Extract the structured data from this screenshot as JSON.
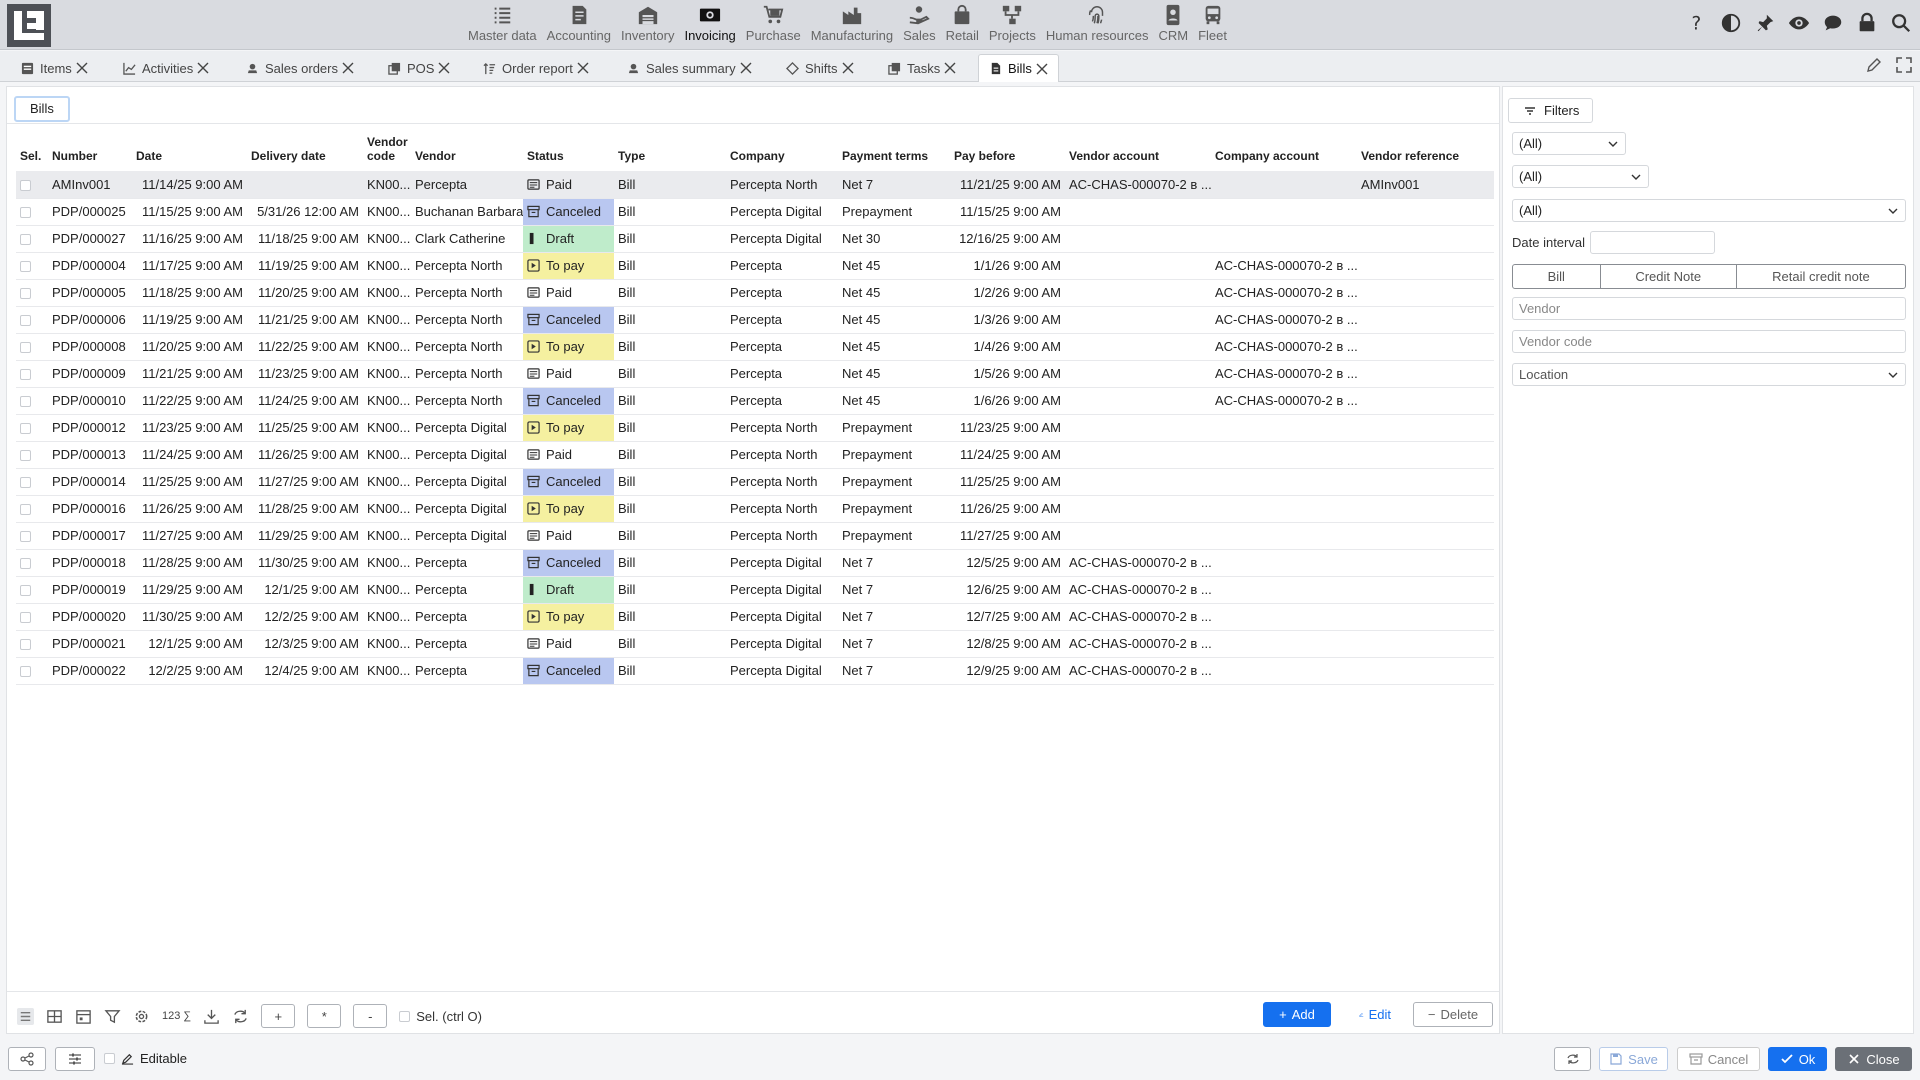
{
  "modules": [
    {
      "label": "Master data",
      "icon": "list-icon"
    },
    {
      "label": "Accounting",
      "icon": "document-icon"
    },
    {
      "label": "Inventory",
      "icon": "warehouse-icon"
    },
    {
      "label": "Invoicing",
      "icon": "money-icon"
    },
    {
      "label": "Purchase",
      "icon": "cart-icon"
    },
    {
      "label": "Manufacturing",
      "icon": "factory-icon"
    },
    {
      "label": "Sales",
      "icon": "sales-icon"
    },
    {
      "label": "Retail",
      "icon": "shopping-bag-icon"
    },
    {
      "label": "Projects",
      "icon": "projects-icon"
    },
    {
      "label": "Human resources",
      "icon": "fingerprint-icon"
    },
    {
      "label": "CRM",
      "icon": "crm-icon"
    },
    {
      "label": "Fleet",
      "icon": "bus-icon"
    }
  ],
  "active_module": "Invoicing",
  "tabs": [
    {
      "label": "Items"
    },
    {
      "label": "Activities"
    },
    {
      "label": "Sales orders"
    },
    {
      "label": "POS"
    },
    {
      "label": "Order report"
    },
    {
      "label": "Sales summary"
    },
    {
      "label": "Shifts"
    },
    {
      "label": "Tasks"
    },
    {
      "label": "Bills"
    }
  ],
  "subtab": "Bills",
  "columns": [
    "Sel.",
    "Number",
    "Date",
    "Delivery date",
    "Vendor code",
    "Vendor",
    "Status",
    "Type",
    "Company",
    "Payment terms",
    "Pay before",
    "Vendor account",
    "Company account",
    "Vendor reference"
  ],
  "rows": [
    {
      "number": "AMInv001",
      "date": "11/14/25 9:00 AM",
      "delivery": "",
      "vcode": "KN00...",
      "vendor": "Percepta",
      "status": "Paid",
      "type": "Bill",
      "company": "Percepta North",
      "terms": "Net 7",
      "paybefore": "11/21/25 9:00 AM",
      "vaccount": "AC-CHAS-000070-2 в ...",
      "caccount": "",
      "vref": "AMInv001"
    },
    {
      "number": "PDP/000025",
      "date": "11/15/25 9:00 AM",
      "delivery": "5/31/26 12:00 AM",
      "vcode": "KN00...",
      "vendor": "Buchanan Barbara",
      "status": "Canceled",
      "type": "Bill",
      "company": "Percepta Digital",
      "terms": "Prepayment",
      "paybefore": "11/15/25 9:00 AM",
      "vaccount": "",
      "caccount": "",
      "vref": ""
    },
    {
      "number": "PDP/000027",
      "date": "11/16/25 9:00 AM",
      "delivery": "11/18/25 9:00 AM",
      "vcode": "KN00...",
      "vendor": "Clark Catherine",
      "status": "Draft",
      "type": "Bill",
      "company": "Percepta Digital",
      "terms": "Net 30",
      "paybefore": "12/16/25 9:00 AM",
      "vaccount": "",
      "caccount": "",
      "vref": ""
    },
    {
      "number": "PDP/000004",
      "date": "11/17/25 9:00 AM",
      "delivery": "11/19/25 9:00 AM",
      "vcode": "KN00...",
      "vendor": "Percepta North",
      "status": "To pay",
      "type": "Bill",
      "company": "Percepta",
      "terms": "Net 45",
      "paybefore": "1/1/26 9:00 AM",
      "vaccount": "",
      "caccount": "AC-CHAS-000070-2 в ...",
      "vref": ""
    },
    {
      "number": "PDP/000005",
      "date": "11/18/25 9:00 AM",
      "delivery": "11/20/25 9:00 AM",
      "vcode": "KN00...",
      "vendor": "Percepta North",
      "status": "Paid",
      "type": "Bill",
      "company": "Percepta",
      "terms": "Net 45",
      "paybefore": "1/2/26 9:00 AM",
      "vaccount": "",
      "caccount": "AC-CHAS-000070-2 в ...",
      "vref": ""
    },
    {
      "number": "PDP/000006",
      "date": "11/19/25 9:00 AM",
      "delivery": "11/21/25 9:00 AM",
      "vcode": "KN00...",
      "vendor": "Percepta North",
      "status": "Canceled",
      "type": "Bill",
      "company": "Percepta",
      "terms": "Net 45",
      "paybefore": "1/3/26 9:00 AM",
      "vaccount": "",
      "caccount": "AC-CHAS-000070-2 в ...",
      "vref": ""
    },
    {
      "number": "PDP/000008",
      "date": "11/20/25 9:00 AM",
      "delivery": "11/22/25 9:00 AM",
      "vcode": "KN00...",
      "vendor": "Percepta North",
      "status": "To pay",
      "type": "Bill",
      "company": "Percepta",
      "terms": "Net 45",
      "paybefore": "1/4/26 9:00 AM",
      "vaccount": "",
      "caccount": "AC-CHAS-000070-2 в ...",
      "vref": ""
    },
    {
      "number": "PDP/000009",
      "date": "11/21/25 9:00 AM",
      "delivery": "11/23/25 9:00 AM",
      "vcode": "KN00...",
      "vendor": "Percepta North",
      "status": "Paid",
      "type": "Bill",
      "company": "Percepta",
      "terms": "Net 45",
      "paybefore": "1/5/26 9:00 AM",
      "vaccount": "",
      "caccount": "AC-CHAS-000070-2 в ...",
      "vref": ""
    },
    {
      "number": "PDP/000010",
      "date": "11/22/25 9:00 AM",
      "delivery": "11/24/25 9:00 AM",
      "vcode": "KN00...",
      "vendor": "Percepta North",
      "status": "Canceled",
      "type": "Bill",
      "company": "Percepta",
      "terms": "Net 45",
      "paybefore": "1/6/26 9:00 AM",
      "vaccount": "",
      "caccount": "AC-CHAS-000070-2 в ...",
      "vref": ""
    },
    {
      "number": "PDP/000012",
      "date": "11/23/25 9:00 AM",
      "delivery": "11/25/25 9:00 AM",
      "vcode": "KN00...",
      "vendor": "Percepta Digital",
      "status": "To pay",
      "type": "Bill",
      "company": "Percepta North",
      "terms": "Prepayment",
      "paybefore": "11/23/25 9:00 AM",
      "vaccount": "",
      "caccount": "",
      "vref": ""
    },
    {
      "number": "PDP/000013",
      "date": "11/24/25 9:00 AM",
      "delivery": "11/26/25 9:00 AM",
      "vcode": "KN00...",
      "vendor": "Percepta Digital",
      "status": "Paid",
      "type": "Bill",
      "company": "Percepta North",
      "terms": "Prepayment",
      "paybefore": "11/24/25 9:00 AM",
      "vaccount": "",
      "caccount": "",
      "vref": ""
    },
    {
      "number": "PDP/000014",
      "date": "11/25/25 9:00 AM",
      "delivery": "11/27/25 9:00 AM",
      "vcode": "KN00...",
      "vendor": "Percepta Digital",
      "status": "Canceled",
      "type": "Bill",
      "company": "Percepta North",
      "terms": "Prepayment",
      "paybefore": "11/25/25 9:00 AM",
      "vaccount": "",
      "caccount": "",
      "vref": ""
    },
    {
      "number": "PDP/000016",
      "date": "11/26/25 9:00 AM",
      "delivery": "11/28/25 9:00 AM",
      "vcode": "KN00...",
      "vendor": "Percepta Digital",
      "status": "To pay",
      "type": "Bill",
      "company": "Percepta North",
      "terms": "Prepayment",
      "paybefore": "11/26/25 9:00 AM",
      "vaccount": "",
      "caccount": "",
      "vref": ""
    },
    {
      "number": "PDP/000017",
      "date": "11/27/25 9:00 AM",
      "delivery": "11/29/25 9:00 AM",
      "vcode": "KN00...",
      "vendor": "Percepta Digital",
      "status": "Paid",
      "type": "Bill",
      "company": "Percepta North",
      "terms": "Prepayment",
      "paybefore": "11/27/25 9:00 AM",
      "vaccount": "",
      "caccount": "",
      "vref": ""
    },
    {
      "number": "PDP/000018",
      "date": "11/28/25 9:00 AM",
      "delivery": "11/30/25 9:00 AM",
      "vcode": "KN00...",
      "vendor": "Percepta",
      "status": "Canceled",
      "type": "Bill",
      "company": "Percepta Digital",
      "terms": "Net 7",
      "paybefore": "12/5/25 9:00 AM",
      "vaccount": "AC-CHAS-000070-2 в ...",
      "caccount": "",
      "vref": ""
    },
    {
      "number": "PDP/000019",
      "date": "11/29/25 9:00 AM",
      "delivery": "12/1/25 9:00 AM",
      "vcode": "KN00...",
      "vendor": "Percepta",
      "status": "Draft",
      "type": "Bill",
      "company": "Percepta Digital",
      "terms": "Net 7",
      "paybefore": "12/6/25 9:00 AM",
      "vaccount": "AC-CHAS-000070-2 в ...",
      "caccount": "",
      "vref": ""
    },
    {
      "number": "PDP/000020",
      "date": "11/30/25 9:00 AM",
      "delivery": "12/2/25 9:00 AM",
      "vcode": "KN00...",
      "vendor": "Percepta",
      "status": "To pay",
      "type": "Bill",
      "company": "Percepta Digital",
      "terms": "Net 7",
      "paybefore": "12/7/25 9:00 AM",
      "vaccount": "AC-CHAS-000070-2 в ...",
      "caccount": "",
      "vref": ""
    },
    {
      "number": "PDP/000021",
      "date": "12/1/25 9:00 AM",
      "delivery": "12/3/25 9:00 AM",
      "vcode": "KN00...",
      "vendor": "Percepta",
      "status": "Paid",
      "type": "Bill",
      "company": "Percepta Digital",
      "terms": "Net 7",
      "paybefore": "12/8/25 9:00 AM",
      "vaccount": "AC-CHAS-000070-2 в ...",
      "caccount": "",
      "vref": ""
    },
    {
      "number": "PDP/000022",
      "date": "12/2/25 9:00 AM",
      "delivery": "12/4/25 9:00 AM",
      "vcode": "KN00...",
      "vendor": "Percepta",
      "status": "Canceled",
      "type": "Bill",
      "company": "Percepta Digital",
      "terms": "Net 7",
      "paybefore": "12/9/25 9:00 AM",
      "vaccount": "AC-CHAS-000070-2 в ...",
      "caccount": "",
      "vref": ""
    }
  ],
  "status_colors": {
    "Paid": "",
    "Canceled": "#b9c7f0",
    "Draft": "#bfeccb",
    "To pay": "#f5f0a0"
  },
  "bottom_toolbar": {
    "counter_label": "123 ∑",
    "plus": "+",
    "asterisk": "*",
    "minus": "-",
    "sel_label": "Sel. (ctrl O)"
  },
  "actions": {
    "add": "Add",
    "edit": "Edit",
    "delete": "Delete"
  },
  "filters": {
    "tab_label": "Filters",
    "select1": "(All)",
    "select2": "(All)",
    "select3": "(All)",
    "date_interval_label": "Date interval",
    "date_interval_value": "",
    "type_segments": [
      "Bill",
      "Credit Note",
      "Retail credit note"
    ],
    "vendor_placeholder": "Vendor",
    "vendor_code_placeholder": "Vendor code",
    "location_placeholder": "Location"
  },
  "footer": {
    "editable_label": "Editable",
    "save": "Save",
    "cancel": "Cancel",
    "ok": "Ok",
    "close": "Close"
  },
  "colors": {
    "accent": "#1570ef",
    "close_button": "#6b7077"
  }
}
